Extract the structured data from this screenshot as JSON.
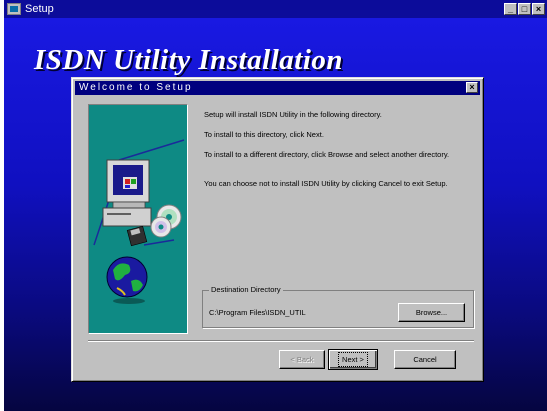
{
  "window": {
    "title": "Setup",
    "controls": {
      "minimize": "_",
      "maximize": "□",
      "close": "×"
    }
  },
  "banner": {
    "title": "ISDN Utility Installation"
  },
  "dialog": {
    "title": "Welcome to Setup",
    "close_glyph": "×",
    "messages": [
      "Setup will install ISDN Utility in the following directory.",
      "To install to this directory, click Next.",
      "To install to a different directory, click Browse and select another directory.",
      "You can choose not to install ISDN Utility by clicking Cancel to exit Setup."
    ],
    "destination": {
      "legend": "Destination Directory",
      "path": "C:\\Program Files\\ISDN_UTIL",
      "browse_label": "Browse..."
    },
    "buttons": {
      "back_label": "< Back",
      "next_label": "Next >",
      "cancel_label": "Cancel"
    }
  },
  "icons": {
    "setup": "setup-app-icon",
    "computer": "computer-icon",
    "cd": "cd-disc-icon",
    "floppy": "floppy-disk-icon",
    "globe": "globe-icon"
  },
  "colors": {
    "desktop_top": "#1a1ae6",
    "desktop_bottom": "#050540",
    "titlebar": "#0c0c9a",
    "dialog_face": "#c0c0c0",
    "dialog_title": "#00007f",
    "art_panel": "#0e8a84"
  }
}
